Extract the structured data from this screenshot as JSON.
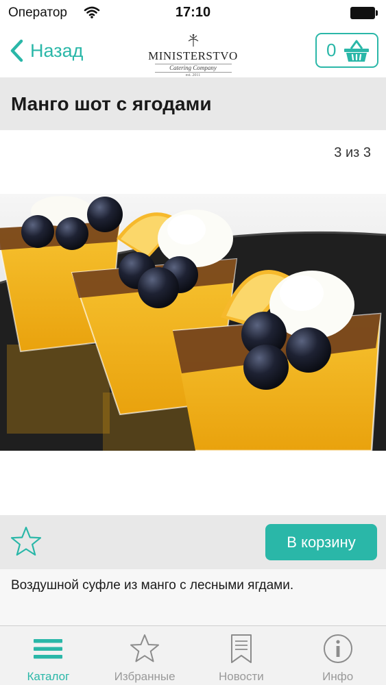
{
  "status_bar": {
    "carrier": "Оператор",
    "time": "17:10"
  },
  "nav": {
    "back_label": "Назад",
    "logo_name": "MINISTERSTVO",
    "logo_subtitle": "Catering Company",
    "logo_est": "est. 2011",
    "cart_count": "0"
  },
  "product": {
    "title": "Манго шот с ягодами",
    "pager": "3 из 3",
    "add_to_cart_label": "В корзину",
    "description": "Воздушной суфле из манго с лесными ягдами."
  },
  "tabs": [
    {
      "label": "Каталог",
      "icon": "menu-icon",
      "active": true
    },
    {
      "label": "Избранные",
      "icon": "star-icon",
      "active": false
    },
    {
      "label": "Новости",
      "icon": "bookmark-icon",
      "active": false
    },
    {
      "label": "Инфо",
      "icon": "info-icon",
      "active": false
    }
  ],
  "colors": {
    "accent": "#2ab7a8",
    "bar_background": "#e8e8e8",
    "inactive_tab": "#999999"
  }
}
